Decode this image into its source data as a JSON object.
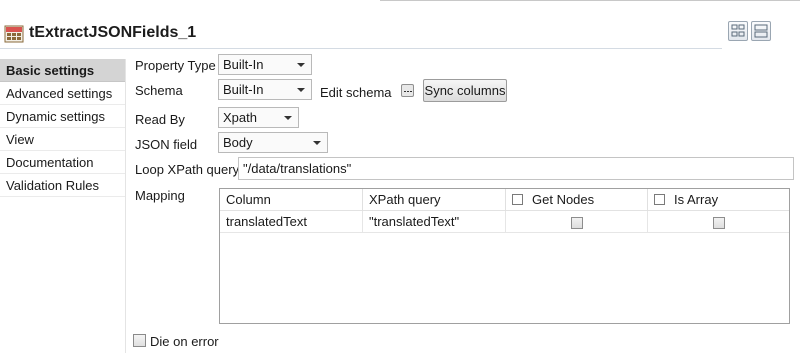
{
  "header": {
    "title": "tExtractJSONFields_1"
  },
  "nav": {
    "items": [
      {
        "label": "Basic settings"
      },
      {
        "label": "Advanced settings"
      },
      {
        "label": "Dynamic settings"
      },
      {
        "label": "View"
      },
      {
        "label": "Documentation"
      },
      {
        "label": "Validation Rules"
      }
    ],
    "active": "Basic settings"
  },
  "form": {
    "property_type_label": "Property Type",
    "property_type_value": "Built-In",
    "schema_label": "Schema",
    "schema_value": "Built-In",
    "edit_schema_label": "Edit schema",
    "sync_columns_label": "Sync columns",
    "read_by_label": "Read By",
    "read_by_value": "Xpath",
    "json_field_label": "JSON field",
    "json_field_value": "Body",
    "loop_xpath_label": "Loop XPath query",
    "loop_xpath_value": "\"/data/translations\"",
    "mapping_label": "Mapping",
    "die_on_error_label": "Die on error",
    "die_on_error_checked": false
  },
  "mapping": {
    "columns": [
      "Column",
      "XPath query",
      "Get Nodes",
      "Is Array"
    ],
    "rows": [
      {
        "column": "translatedText",
        "xpath": "\"translatedText\"",
        "get_nodes": false,
        "is_array": false
      }
    ]
  },
  "colors": {
    "nav_active_bg": "#d4d4d4",
    "border": "#a0a0a0"
  },
  "icons": {
    "component": "tool-component-icon",
    "header_btn_1": "layout-grid-icon",
    "header_btn_2": "layout-rows-icon",
    "edit_schema": "ellipsis-icon"
  }
}
